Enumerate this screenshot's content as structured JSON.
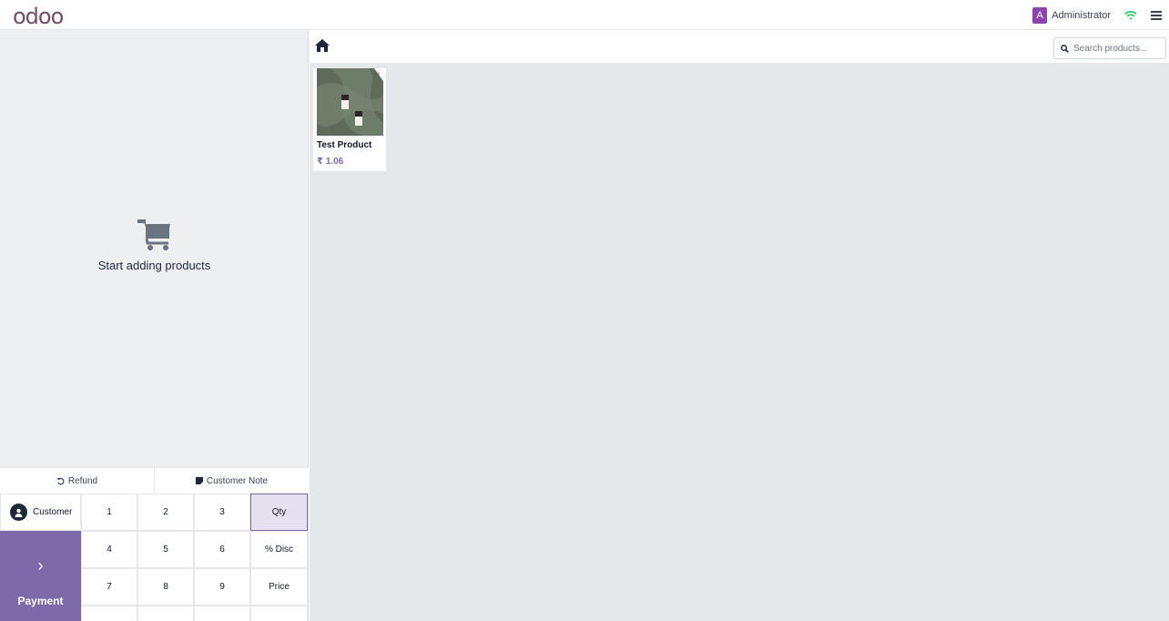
{
  "header": {
    "logo": "odoo",
    "user_initial": "A",
    "user_name": "Administrator",
    "icons": [
      "wifi-icon",
      "menu-icon"
    ]
  },
  "order": {
    "empty_message": "Start adding products",
    "refund_label": "Refund",
    "customer_note_label": "Customer Note",
    "customer_label": "Customer",
    "payment_label": "Payment",
    "payment_arrow": "›"
  },
  "numpad": {
    "keys": [
      "1",
      "2",
      "3",
      "4",
      "5",
      "6",
      "7",
      "8",
      "9"
    ],
    "modes": [
      "Qty",
      "% Disc",
      "Price"
    ],
    "active_mode": "Qty"
  },
  "products_toolbar": {
    "search_placeholder": "Search products..."
  },
  "products": [
    {
      "name": "Test Product",
      "price": "₹ 1.06"
    }
  ],
  "colors": {
    "accent": "#7c6aa8",
    "avatar": "#8e44ad",
    "wifi": "#22c55e",
    "product_area_bg": "#e5e8eb"
  }
}
